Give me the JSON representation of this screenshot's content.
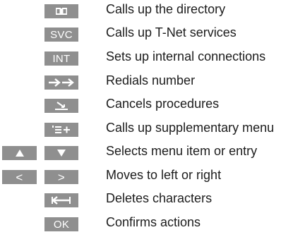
{
  "legend": {
    "items": [
      {
        "key_icon": "open-book-icon",
        "description": "Calls up the directory"
      },
      {
        "key_label": "SVC",
        "description": "Calls up T-Net services"
      },
      {
        "key_label": "INT",
        "description": "Sets up internal connections"
      },
      {
        "key_icon": "double-arrow-right-icon",
        "description": "Redials number"
      },
      {
        "key_icon": "cancel-hook-icon",
        "description": "Cancels procedures"
      },
      {
        "key_icon": "menu-plus-icon",
        "description": "Calls up supplementary menu"
      },
      {
        "key_icons": [
          "triangle-up-icon",
          "triangle-down-icon"
        ],
        "description": "Selects menu item or entry"
      },
      {
        "key_labels": [
          "<",
          ">"
        ],
        "description": "Moves to left or right"
      },
      {
        "key_icon": "backspace-arrow-icon",
        "description": "Deletes characters"
      },
      {
        "key_label": "OK",
        "description": "Confirms actions"
      }
    ]
  },
  "colors": {
    "key_background": "#8f8f8f",
    "key_foreground": "#ffffff",
    "text": "#1c1c1c",
    "background": "#ffffff"
  }
}
